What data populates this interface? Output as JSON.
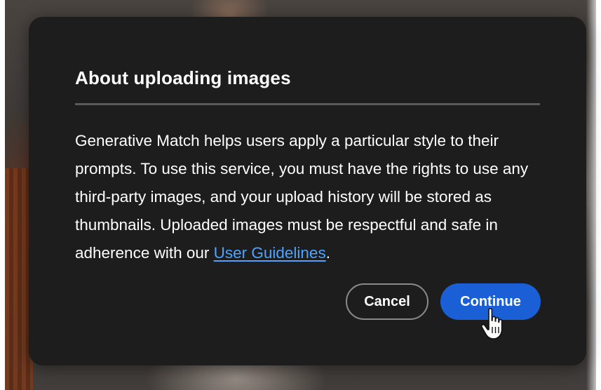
{
  "dialog": {
    "title": "About uploading images",
    "body_before_link": "Generative Match helps users apply a particular style to their prompts. To use this service, you must have the rights to use any third-party images, and your upload history will be stored as thumbnails. Uploaded images must be respectful and safe in adherence with our ",
    "link_label": "User Guidelines",
    "body_after_link": ".",
    "cancel_label": "Cancel",
    "continue_label": "Continue"
  },
  "colors": {
    "dialog_background": "#1d1d1d",
    "primary_button": "#1b5fd6",
    "link": "#4fa3ff",
    "divider": "#5a5a5a"
  },
  "icons": {
    "cursor": "hand-pointer-icon"
  }
}
